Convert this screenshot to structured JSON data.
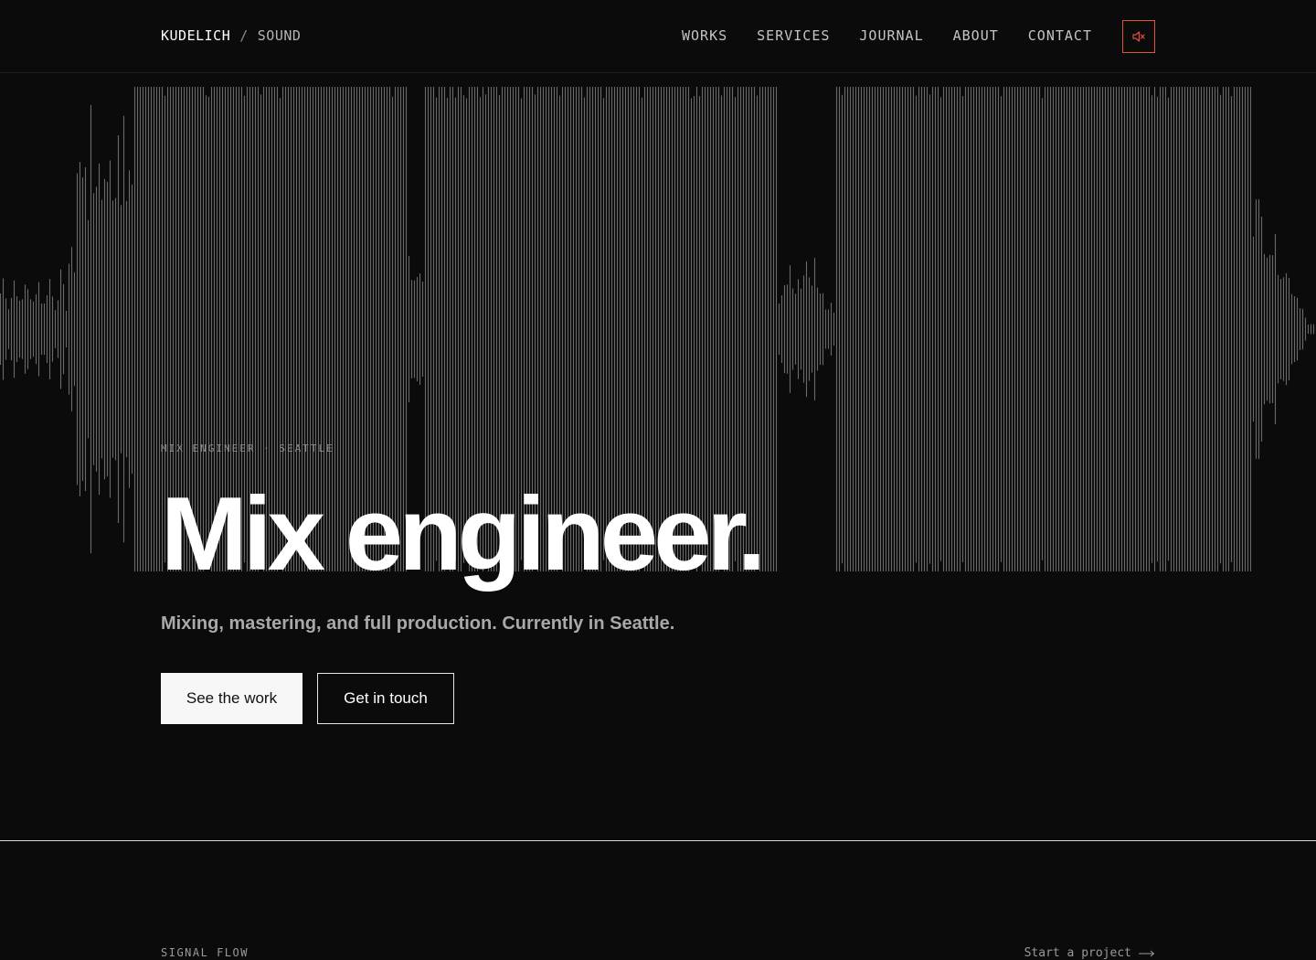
{
  "header": {
    "brand": "KUDELICH",
    "separator": "/",
    "section": "SOUND",
    "nav": [
      "WORKS",
      "SERVICES",
      "JOURNAL",
      "ABOUT",
      "CONTACT"
    ],
    "mute_icon": "speaker-muted-icon"
  },
  "hero": {
    "eyebrow": "MIX ENGINEER · SEATTLE",
    "headline": "Mix engineer.",
    "subline": "Mixing, mastering, and full production. Currently in Seattle.",
    "primary_button": "See the work",
    "secondary_button": "Get in touch"
  },
  "signal_flow": {
    "label": "SIGNAL FLOW",
    "link": "Start a project",
    "link_icon": "arrow-right-icon"
  },
  "colors": {
    "background": "#0b0b0b",
    "accent": "#e4513c",
    "waveform": "#8a8a8a"
  }
}
